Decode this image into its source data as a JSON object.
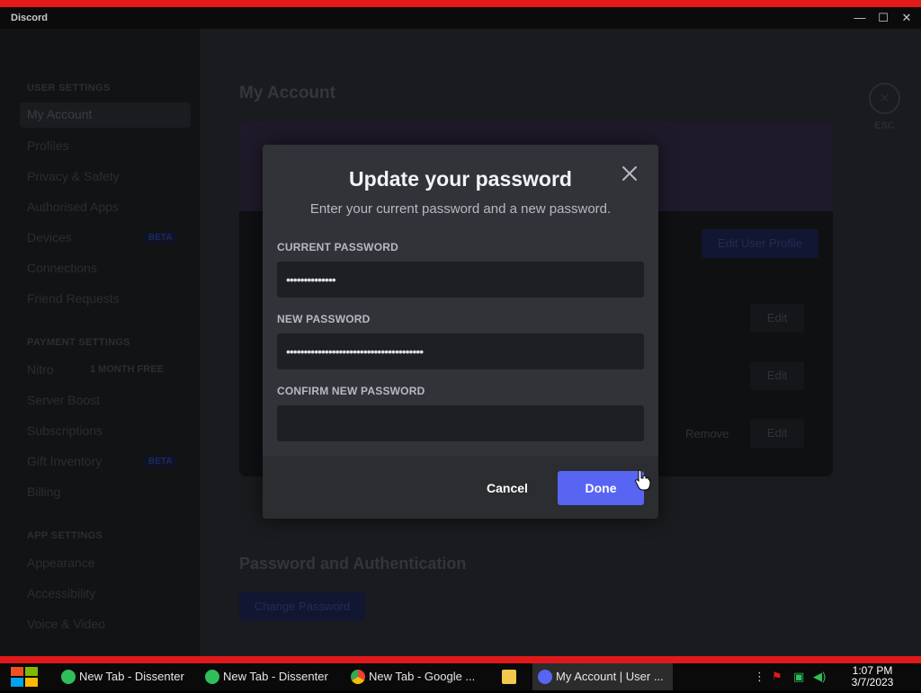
{
  "window": {
    "app_name": "Discord",
    "min": "—",
    "max": "☐",
    "close": "✕"
  },
  "sidebar": {
    "user_settings_header": "USER SETTINGS",
    "items_user": [
      "My Account",
      "Profiles",
      "Privacy & Safety",
      "Authorised Apps",
      "Devices",
      "Connections",
      "Friend Requests"
    ],
    "payment_header": "PAYMENT SETTINGS",
    "items_payment": [
      "Nitro",
      "Server Boost",
      "Subscriptions",
      "Gift Inventory",
      "Billing"
    ],
    "nitro_badge": "1 MONTH FREE",
    "beta_badge": "BETA",
    "app_header": "APP SETTINGS",
    "items_app": [
      "Appearance",
      "Accessibility",
      "Voice & Video"
    ]
  },
  "main": {
    "title": "My Account",
    "edit_profile_label": "Edit User Profile",
    "edit_label": "Edit",
    "remove_label": "Remove",
    "password_section_title": "Password and Authentication",
    "change_password_label": "Change Password",
    "esc_label": "ESC"
  },
  "modal": {
    "title": "Update your password",
    "subtitle": "Enter your current password and a new password.",
    "current_label": "CURRENT PASSWORD",
    "current_value": "••••••••••••••",
    "new_label": "NEW PASSWORD",
    "new_value": "•••••••••••••••••••••••••••••••••••••••",
    "confirm_label": "CONFIRM NEW PASSWORD",
    "confirm_value": "",
    "cancel_label": "Cancel",
    "done_label": "Done"
  },
  "taskbar": {
    "items": [
      {
        "label": "New Tab - Dissenter",
        "icon": "dissenter-icon"
      },
      {
        "label": "New Tab - Dissenter",
        "icon": "dissenter-icon"
      },
      {
        "label": "New Tab - Google ...",
        "icon": "chrome-icon"
      },
      {
        "label": "",
        "icon": "folder-icon"
      },
      {
        "label": "My Account | User ...",
        "icon": "discord-icon"
      }
    ],
    "time": "1:07 PM",
    "date": "3/7/2023"
  },
  "colors": {
    "accent": "#5865f2",
    "modal_bg": "#313338",
    "input_bg": "#1e1f22",
    "red_strip": "#e0191b"
  }
}
